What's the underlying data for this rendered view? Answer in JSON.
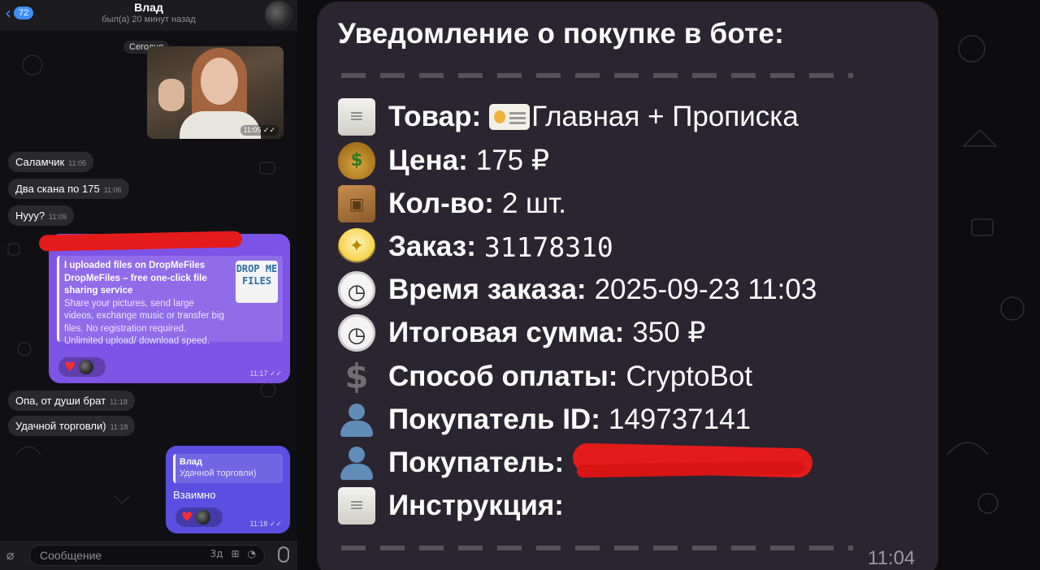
{
  "chat": {
    "header": {
      "unread_count": "72",
      "contact_name": "Влад",
      "contact_status": "был(а) 20 минут назад"
    },
    "date_label": "Сегодня",
    "photo_time": "11:05",
    "messages": [
      {
        "text": "Саламчик",
        "time": "11:05"
      },
      {
        "text": "Два скана по 175",
        "time": "11:06"
      },
      {
        "text": "Нууу?",
        "time": "11:09"
      }
    ],
    "link_card": {
      "title": "I uploaded files on DropMeFiles",
      "subtitle": "DropMeFiles – free one-click file sharing service",
      "description": "Share your pictures, send large videos, exchange music or transfer big files. No registration required. Unlimited upload/ download speed.",
      "thumb_text": "DROP ME FILES",
      "time": "11:17"
    },
    "messages2": [
      {
        "text": "Опа, от души брат",
        "time": "11:18"
      },
      {
        "text": "Удачной торговли)",
        "time": "11:18"
      }
    ],
    "reply_card": {
      "quote_name": "Влад",
      "quote_text": "Удачной торговли)",
      "text": "Взаимно",
      "time": "11:18"
    },
    "input": {
      "placeholder": "Сообщение",
      "sticker_label": "3д"
    }
  },
  "bot": {
    "title": "Уведомление о покупке в боте:",
    "rows": {
      "product": {
        "label": "Товар:",
        "value": "Главная + Прописка",
        "icon": "scroll-icon"
      },
      "price": {
        "label": "Цена:",
        "value": "175 ₽",
        "icon": "money-bag-icon"
      },
      "qty": {
        "label": "Кол-во:",
        "value": "2 шт.",
        "icon": "package-icon"
      },
      "order": {
        "label": "Заказ:",
        "value": "31178310",
        "icon": "bulb-icon"
      },
      "order_time": {
        "label": "Время заказа:",
        "value": "2025-09-23 11:03",
        "icon": "clock-icon"
      },
      "total": {
        "label": "Итоговая сумма:",
        "value": "350 ₽",
        "icon": "clock-icon"
      },
      "payment": {
        "label": "Способ оплаты:",
        "value": "CryptoBot",
        "icon": "dollar-icon"
      },
      "buyer_id": {
        "label": "Покупатель ID:",
        "value": "149737141",
        "icon": "person-icon"
      },
      "buyer": {
        "label": "Покупатель:",
        "value": "",
        "icon": "person-icon"
      },
      "instruction": {
        "label": "Инструкция:",
        "value": "",
        "icon": "scroll-icon"
      }
    },
    "time": "11:04",
    "colors": {
      "bubble": "#2a2530",
      "outgoing": "#7e54e6",
      "redaction": "#e31b1b"
    }
  }
}
